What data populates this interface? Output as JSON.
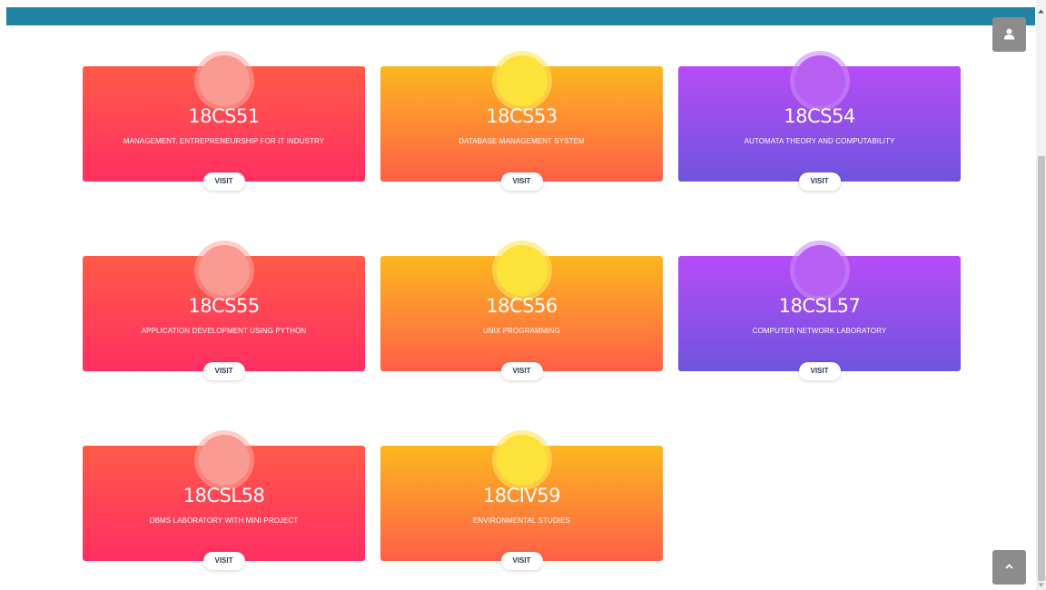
{
  "cards": [
    {
      "code": "18CS51",
      "subject": "MANAGEMENT, ENTREPRENEURSHIP FOR IT INDUSTRY",
      "visit": "VISIT",
      "color": "red"
    },
    {
      "code": "18CS53",
      "subject": "DATABASE MANAGEMENT SYSTEM",
      "visit": "VISIT",
      "color": "orange"
    },
    {
      "code": "18CS54",
      "subject": "AUTOMATA THEORY AND COMPUTABILITY",
      "visit": "VISIT",
      "color": "purple"
    },
    {
      "code": "18CS55",
      "subject": "APPLICATION DEVELOPMENT USING PYTHON",
      "visit": "VISIT",
      "color": "red"
    },
    {
      "code": "18CS56",
      "subject": "UNIX PROGRAMMING",
      "visit": "VISIT",
      "color": "orange"
    },
    {
      "code": "18CSL57",
      "subject": "COMPUTER NETWORK LABORATORY",
      "visit": "VISIT",
      "color": "purple"
    },
    {
      "code": "18CSL58",
      "subject": "DBMS LABORATORY WITH MINI PROJECT",
      "visit": "VISIT",
      "color": "red"
    },
    {
      "code": "18CIV59",
      "subject": "ENVIRONMENTAL STUDIES",
      "visit": "VISIT",
      "color": "orange"
    }
  ],
  "icons": {
    "profile": "user-icon",
    "back_to_top": "chevron-up-icon"
  },
  "colors": {
    "banner": "#2183a3",
    "red_card": "#ff3f58",
    "orange_card": "#fd9a30",
    "purple_card": "#9350ea",
    "floating_button": "#8c8c8c"
  }
}
